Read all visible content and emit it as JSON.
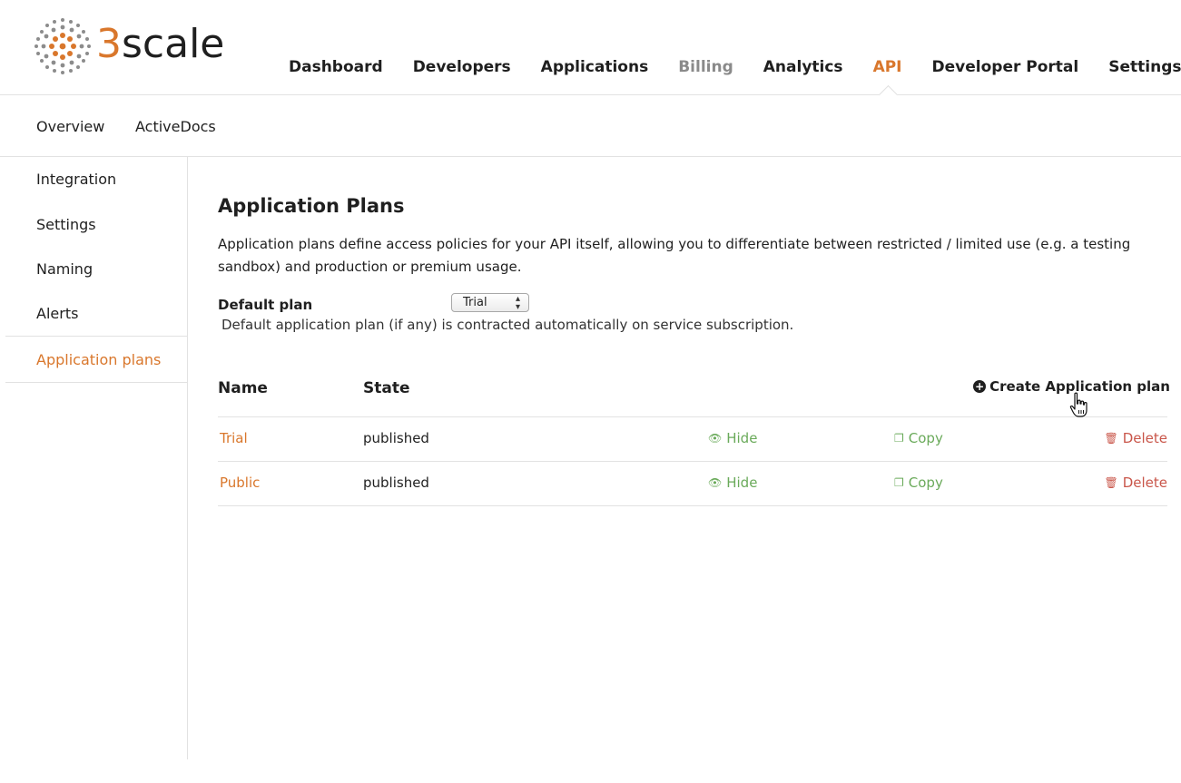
{
  "logo": {
    "prefix": "3",
    "suffix": "scale"
  },
  "mainnav": {
    "items": [
      {
        "label": "Dashboard",
        "state": "normal"
      },
      {
        "label": "Developers",
        "state": "normal"
      },
      {
        "label": "Applications",
        "state": "normal"
      },
      {
        "label": "Billing",
        "state": "muted"
      },
      {
        "label": "Analytics",
        "state": "normal"
      },
      {
        "label": "API",
        "state": "active"
      },
      {
        "label": "Developer Portal",
        "state": "normal"
      },
      {
        "label": "Settings",
        "state": "normal"
      }
    ]
  },
  "subnav": {
    "items": [
      {
        "label": "Overview"
      },
      {
        "label": "ActiveDocs"
      }
    ]
  },
  "sidebar": {
    "items": [
      {
        "label": "Integration"
      },
      {
        "label": "Settings"
      },
      {
        "label": "Naming"
      },
      {
        "label": "Alerts"
      },
      {
        "label": "Application plans",
        "active": true
      }
    ]
  },
  "main": {
    "title": "Application Plans",
    "description": "Application plans define access policies for your API itself, allowing you to differentiate between restricted / limited use (e.g. a testing sandbox) and production or premium usage.",
    "default_plan": {
      "label": "Default plan",
      "selected": "Trial",
      "hint": "Default application plan (if any) is contracted automatically on service subscription."
    },
    "table": {
      "headers": {
        "name": "Name",
        "state": "State"
      },
      "create_label": "Create Application plan",
      "rows": [
        {
          "name": "Trial",
          "state": "published",
          "hide": "Hide",
          "copy": "Copy",
          "delete": "Delete"
        },
        {
          "name": "Public",
          "state": "published",
          "hide": "Hide",
          "copy": "Copy",
          "delete": "Delete"
        }
      ]
    }
  },
  "colors": {
    "accent": "#d9772c",
    "action_green": "#6aaa5a",
    "action_red": "#c9564a",
    "text": "#1f1f1f",
    "border": "#e2e2e2"
  },
  "icons": {
    "create": "plus-circle-icon",
    "hide": "eye-slash-icon",
    "copy": "copy-icon",
    "delete": "trash-icon",
    "cursor": "hand-pointer-icon"
  }
}
